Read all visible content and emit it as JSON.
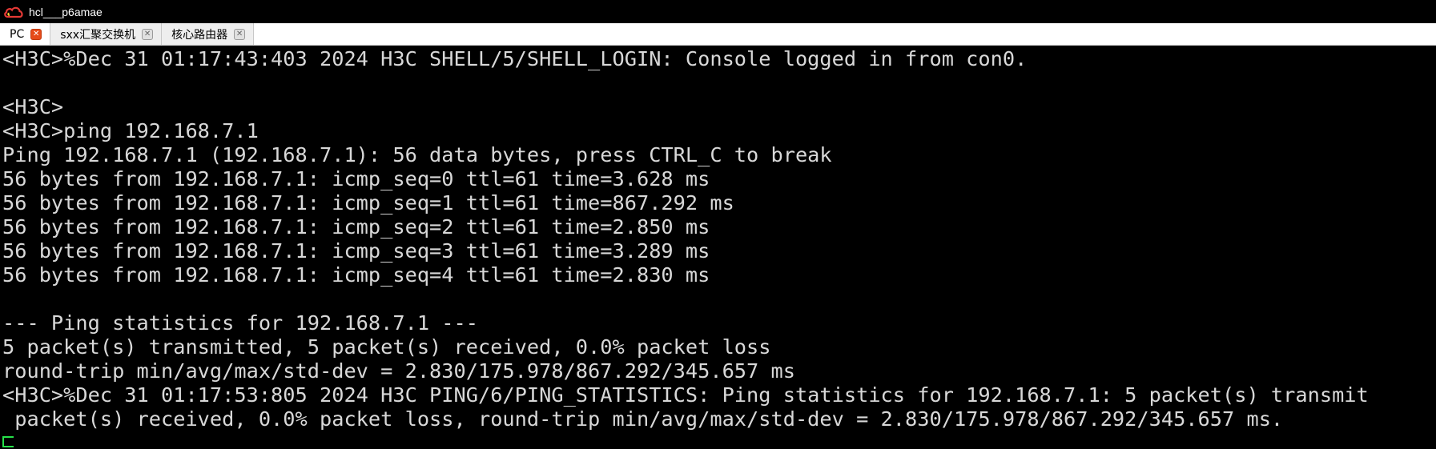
{
  "window": {
    "title": "hcl___p6amae"
  },
  "tabs": [
    {
      "label": "PC",
      "active": true,
      "close_glyph": "✕"
    },
    {
      "label": "sxx汇聚交换机",
      "active": false,
      "close_glyph": "✕"
    },
    {
      "label": "核心路由器",
      "active": false,
      "close_glyph": "✕"
    }
  ],
  "terminal": {
    "lines": [
      "<H3C>%Dec 31 01:17:43:403 2024 H3C SHELL/5/SHELL_LOGIN: Console logged in from con0.",
      "",
      "<H3C>",
      "<H3C>ping 192.168.7.1",
      "Ping 192.168.7.1 (192.168.7.1): 56 data bytes, press CTRL_C to break",
      "56 bytes from 192.168.7.1: icmp_seq=0 ttl=61 time=3.628 ms",
      "56 bytes from 192.168.7.1: icmp_seq=1 ttl=61 time=867.292 ms",
      "56 bytes from 192.168.7.1: icmp_seq=2 ttl=61 time=2.850 ms",
      "56 bytes from 192.168.7.1: icmp_seq=3 ttl=61 time=3.289 ms",
      "56 bytes from 192.168.7.1: icmp_seq=4 ttl=61 time=2.830 ms",
      "",
      "--- Ping statistics for 192.168.7.1 ---",
      "5 packet(s) transmitted, 5 packet(s) received, 0.0% packet loss",
      "round-trip min/avg/max/std-dev = 2.830/175.978/867.292/345.657 ms",
      "<H3C>%Dec 31 01:17:53:805 2024 H3C PING/6/PING_STATISTICS: Ping statistics for 192.168.7.1: 5 packet(s) transmit",
      " packet(s) received, 0.0% packet loss, round-trip min/avg/max/std-dev = 2.830/175.978/867.292/345.657 ms."
    ]
  },
  "colors": {
    "terminal_bg": "#000000",
    "terminal_text": "#d8d8d8",
    "cursor": "#27e24a",
    "active_tab_close": "#e64a19"
  },
  "icons": {
    "app_logo": "cloud-logo-icon",
    "tab_close": "close-icon"
  }
}
